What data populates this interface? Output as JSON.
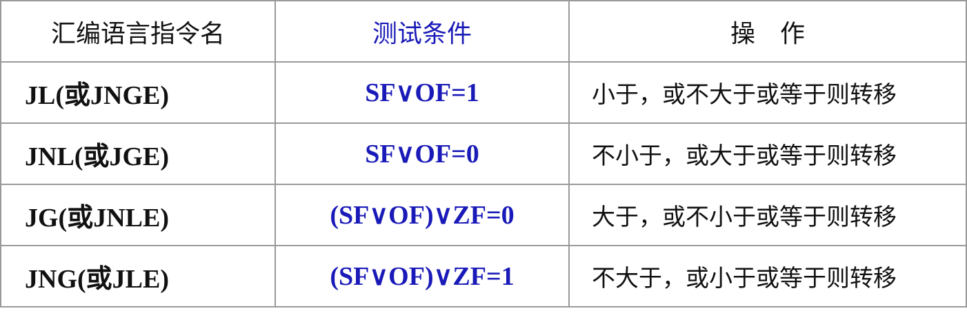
{
  "header": {
    "col1": "汇编语言指令名",
    "col2": "测试条件",
    "col3": "操　作"
  },
  "rows": [
    {
      "instruction": "JL(或JNGE)",
      "condition": "SF∨OF=1",
      "operation": "小于，或不大于或等于则转移"
    },
    {
      "instruction": "JNL(或JGE)",
      "condition": "SF∨OF=0",
      "operation": "不小于，或大于或等于则转移"
    },
    {
      "instruction": "JG(或JNLE)",
      "condition": "(SF∨OF)∨ZF=0",
      "operation": "大于，或不小于或等于则转移"
    },
    {
      "instruction": "JNG(或JLE)",
      "condition": "(SF∨OF)∨ZF=1",
      "operation": "不大于，或小于或等于则转移"
    }
  ],
  "colors": {
    "condition_text": "#1a1ab8",
    "border": "#999999",
    "text": "#111111"
  }
}
